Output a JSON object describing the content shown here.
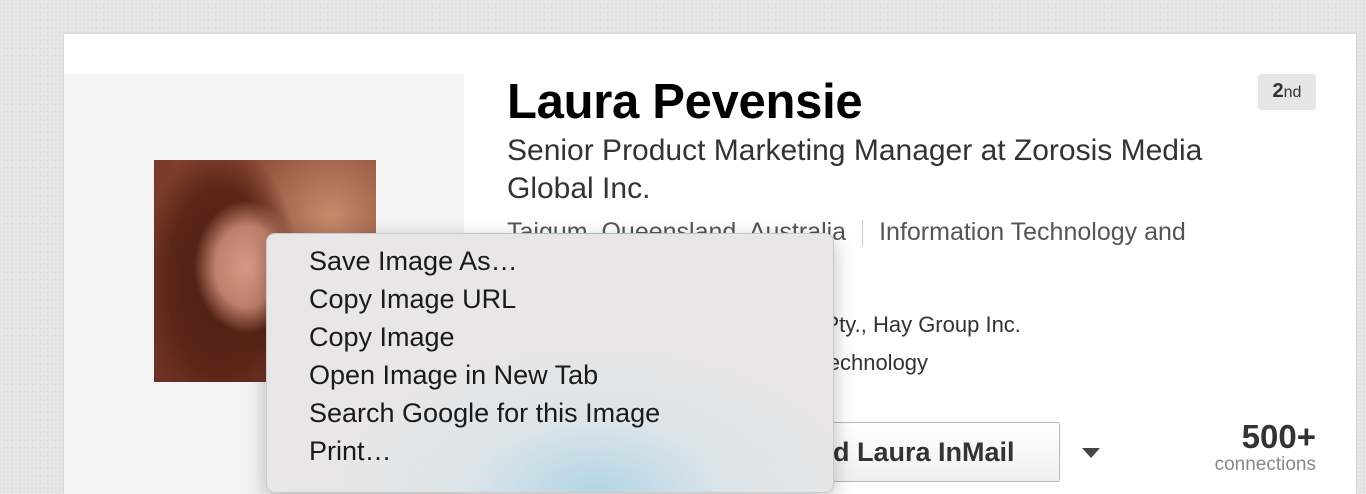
{
  "profile": {
    "name": "Laura Pevensie",
    "degree": {
      "number": "2",
      "suffix": "nd"
    },
    "headline": "Senior Product Marketing Manager at Zorosis Media Global Inc.",
    "location": "Taigum, Queensland, Australia",
    "industry": "Information Technology and",
    "detail_1": "Services Pty., Hay Group Inc.",
    "detail_2": "ersity of Technology",
    "inmail_button": "end Laura InMail",
    "connections_count": "500+",
    "connections_label": "connections"
  },
  "context_menu": {
    "items": [
      "Save Image As…",
      "Copy Image URL",
      "Copy Image",
      "Open Image in New Tab",
      "Search Google for this Image",
      "Print…"
    ]
  },
  "icons": {
    "dropdown": "caret-down-icon"
  }
}
